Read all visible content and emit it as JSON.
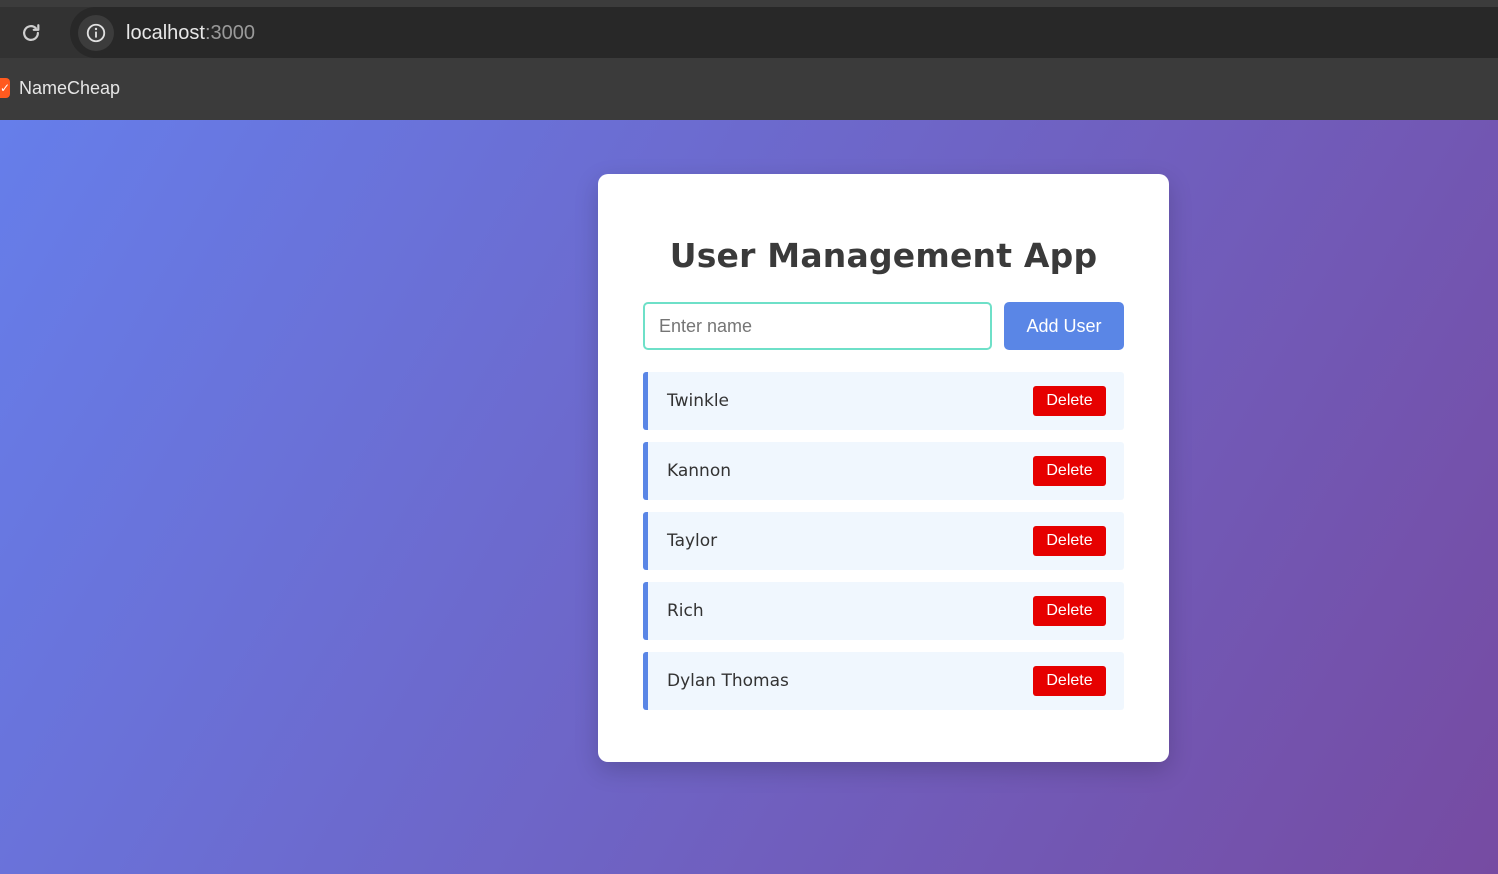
{
  "browser": {
    "url_host": "localhost",
    "url_port": ":3000",
    "reload_icon": "reload-icon",
    "info_icon": "info-icon",
    "bookmarks": [
      {
        "label": "NameCheap",
        "favicon": "namecheap-favicon"
      }
    ]
  },
  "app": {
    "title": "User Management App",
    "input": {
      "value": "",
      "placeholder": "Enter name"
    },
    "add_button_label": "Add User",
    "users": [
      {
        "name": "Twinkle",
        "delete_label": "Delete"
      },
      {
        "name": "Kannon",
        "delete_label": "Delete"
      },
      {
        "name": "Taylor",
        "delete_label": "Delete"
      },
      {
        "name": "Rich",
        "delete_label": "Delete"
      },
      {
        "name": "Dylan Thomas",
        "delete_label": "Delete"
      }
    ]
  },
  "colors": {
    "gradient_start": "#667eea",
    "gradient_end": "#764ba2",
    "primary_button": "#5a86e6",
    "delete_button": "#e60000",
    "input_border": "#6ee0c8",
    "list_item_bg": "#f0f7fe"
  }
}
